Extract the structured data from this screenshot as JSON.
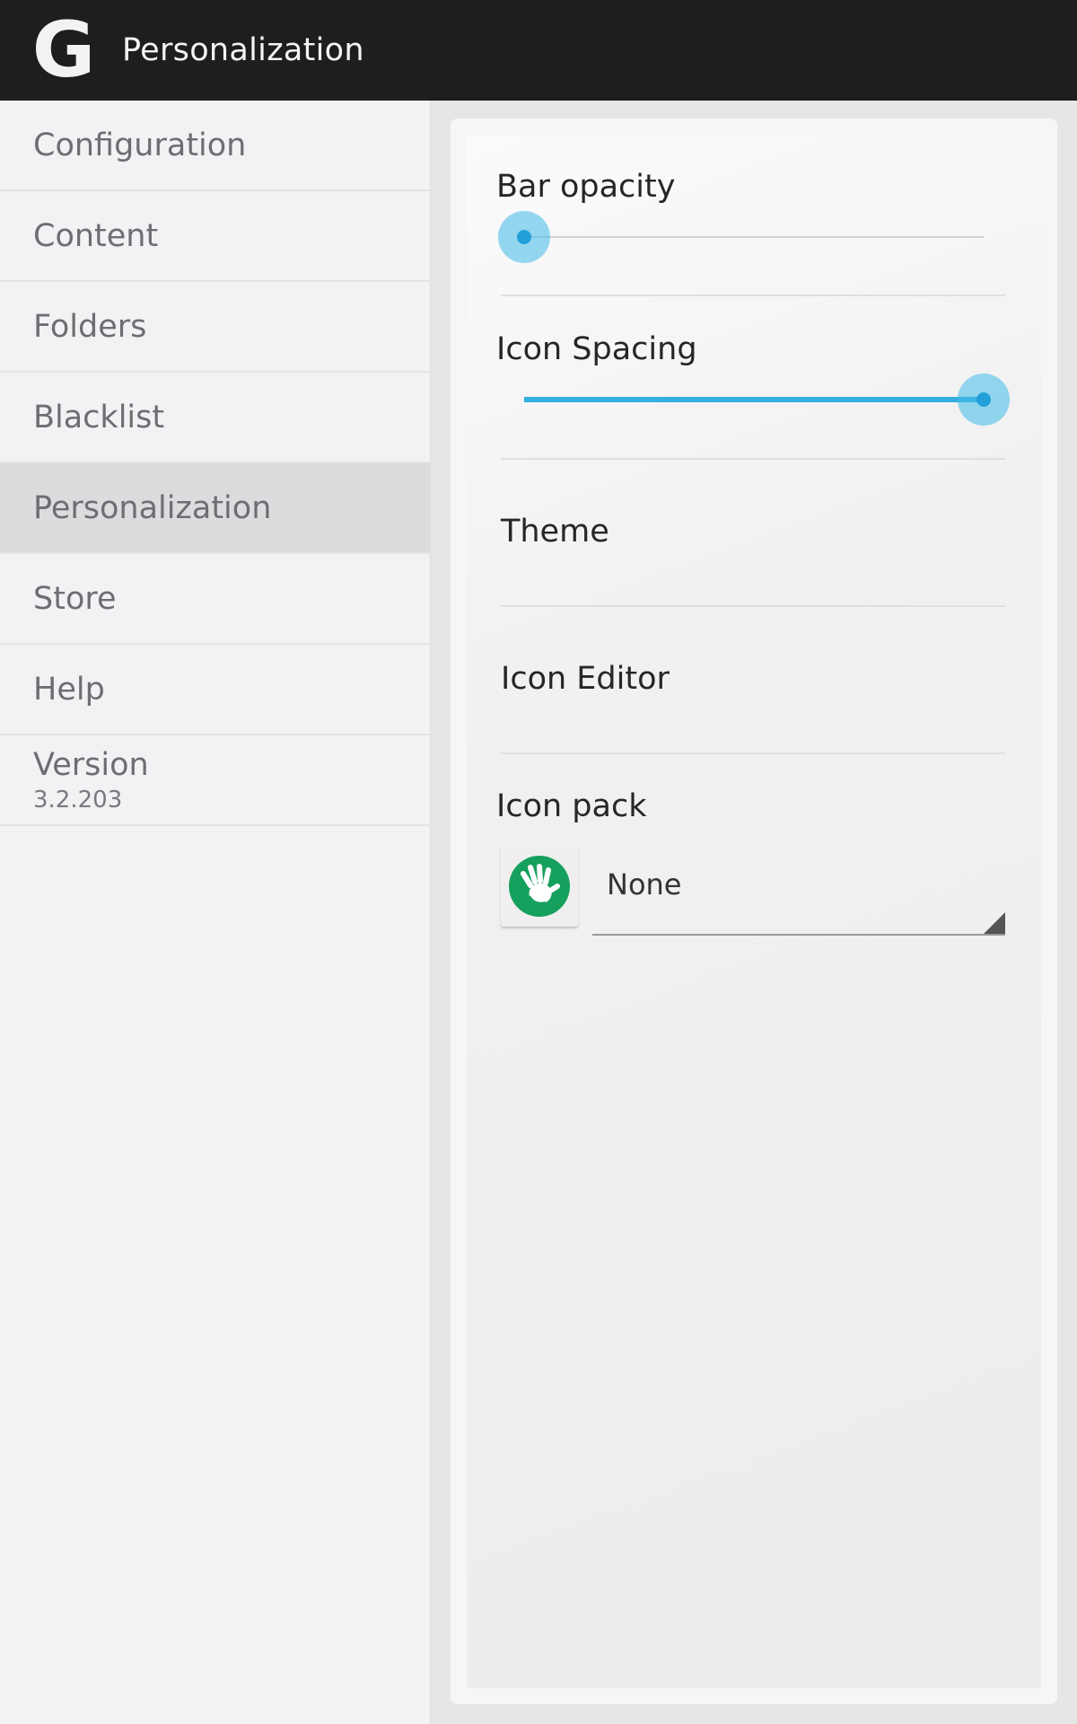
{
  "action_bar": {
    "logo": "G",
    "title": "Personalization"
  },
  "nav": {
    "items": [
      {
        "label": "Configuration"
      },
      {
        "label": "Content"
      },
      {
        "label": "Folders"
      },
      {
        "label": "Blacklist"
      },
      {
        "label": "Personalization",
        "selected": true
      },
      {
        "label": "Store"
      },
      {
        "label": "Help"
      }
    ],
    "version": {
      "label": "Version",
      "value": "3.2.203"
    }
  },
  "settings": {
    "bar_opacity": {
      "title": "Bar opacity",
      "value_fraction": 0.0
    },
    "icon_spacing": {
      "title": "Icon Spacing",
      "value_fraction": 1.0
    },
    "theme": {
      "title": "Theme"
    },
    "icon_editor": {
      "title": "Icon Editor"
    },
    "icon_pack": {
      "title": "Icon pack",
      "selected": "None",
      "icon": "hand-icon"
    }
  },
  "colors": {
    "accent": "#34afe0",
    "action_bar": "#1e1e1e",
    "icon_pack_badge": "#16a05d"
  }
}
